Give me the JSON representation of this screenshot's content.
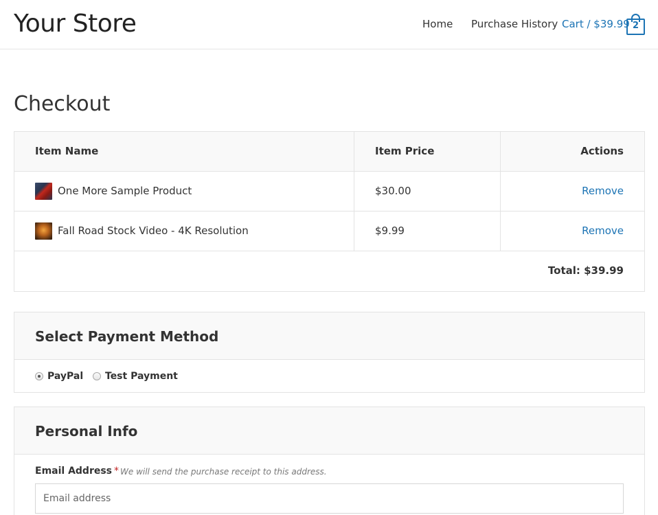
{
  "header": {
    "site_title": "Your Store",
    "nav": {
      "home": "Home",
      "purchase_history": "Purchase History",
      "cart": "Cart / $39.99",
      "cart_count": "2"
    }
  },
  "page": {
    "title": "Checkout"
  },
  "cart_table": {
    "columns": [
      "Item Name",
      "Item Price",
      "Actions"
    ],
    "rows": [
      {
        "thumbnail": "red-car-thumbnail",
        "name": "One More Sample Product",
        "price": "$30.00",
        "action": "Remove"
      },
      {
        "thumbnail": "autumn-road-thumbnail",
        "name": "Fall Road Stock Video - 4K Resolution",
        "price": "$9.99",
        "action": "Remove"
      }
    ],
    "total": "Total: $39.99"
  },
  "payment": {
    "title": "Select Payment Method",
    "options": [
      {
        "label": "PayPal",
        "selected": true
      },
      {
        "label": "Test Payment",
        "selected": false
      }
    ]
  },
  "personal_info": {
    "title": "Personal Info",
    "email_label": "Email Address",
    "required_mark": "*",
    "email_hint": "We will send the purchase receipt to this address.",
    "email_placeholder": "Email address",
    "email_value": ""
  },
  "colors": {
    "link": "#1b73b4",
    "table_header_bg": "#f9f9f9",
    "border": "#e3e3e3",
    "required": "#c02020"
  }
}
